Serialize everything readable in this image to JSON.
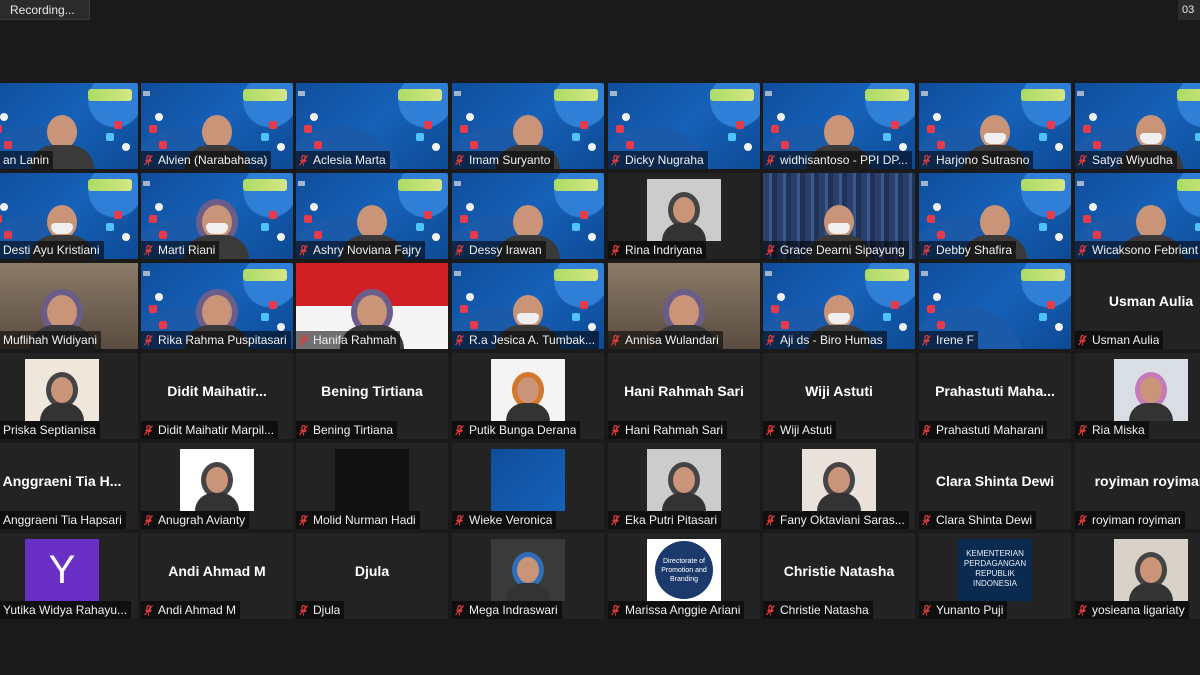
{
  "recording_label": "Recording...",
  "timer_label": "03",
  "colors": {
    "active_speaker": "#d9e86a",
    "muted_mic": "#e23b3b",
    "background": "#1a1a1a"
  },
  "participants": [
    {
      "name": "an Lanin",
      "video": "blue-person"
    },
    {
      "name": "Alvien (Narabahasa)",
      "video": "blue-person",
      "active": true
    },
    {
      "name": "Aclesia Marta",
      "video": "blue"
    },
    {
      "name": "Imam Suryanto",
      "video": "blue-person"
    },
    {
      "name": "Dicky Nugraha",
      "video": "blue"
    },
    {
      "name": "widhisantoso - PPI DP...",
      "video": "blue-person"
    },
    {
      "name": "Harjono Sutrasno",
      "video": "blue-person-mask"
    },
    {
      "name": "Satya Wiyudha",
      "video": "blue-person-mask"
    },
    {
      "name": "Desti Ayu Kristiani",
      "video": "blue-person-mask"
    },
    {
      "name": "Marti Riani",
      "video": "blue-hijab-mask"
    },
    {
      "name": "Ashry Noviana Fajry",
      "video": "blue-person"
    },
    {
      "name": "Dessy Irawan",
      "video": "blue-person"
    },
    {
      "name": "Rina Indriyana",
      "video": "thumb-hijab"
    },
    {
      "name": "Grace Dearni Sipayung",
      "video": "shelf-mask"
    },
    {
      "name": "Debby Shafira",
      "video": "blue-person"
    },
    {
      "name": "Wicaksono Febriant",
      "video": "blue-person"
    },
    {
      "name": "Muflihah Widiyani",
      "video": "room-hijab"
    },
    {
      "name": "Rika Rahma Puspitasari",
      "video": "blue-hijab"
    },
    {
      "name": "Hanifa Rahmah",
      "video": "flag-hijab"
    },
    {
      "name": "R.a Jesica A. Tumbak...",
      "video": "blue-person-mask"
    },
    {
      "name": "Annisa Wulandari",
      "video": "room-hijab"
    },
    {
      "name": "Aji ds - Biro Humas",
      "video": "blue-person-mask"
    },
    {
      "name": "Irene F",
      "video": "blue"
    },
    {
      "name": "Usman Aulia",
      "video": "none",
      "center": "Usman Aulia"
    },
    {
      "name": "Priska Septianisa",
      "video": "thumb-light"
    },
    {
      "name": "Didit Maihatir Marpil...",
      "video": "none",
      "center": "Didit  Maihatir..."
    },
    {
      "name": "Bening Tirtiana",
      "video": "none",
      "center": "Bening Tirtiana"
    },
    {
      "name": "Putik Bunga Derana",
      "video": "thumb-orange"
    },
    {
      "name": "Hani Rahmah Sari",
      "video": "none",
      "center": "Hani Rahmah Sari"
    },
    {
      "name": "Wiji Astuti",
      "video": "none",
      "center": "Wiji Astuti"
    },
    {
      "name": "Prahastuti Maharani",
      "video": "none",
      "center": "Prahastuti  Maha..."
    },
    {
      "name": "Ria Miska",
      "video": "thumb-pink"
    },
    {
      "name": "Anggraeni Tia Hapsari",
      "video": "none",
      "center": "Anggraeni  Tia  H..."
    },
    {
      "name": "Anugrah Avianty",
      "video": "thumb-cartoon"
    },
    {
      "name": "Molid Nurman Hadi",
      "video": "thumb-dark"
    },
    {
      "name": "Wieke Veronica",
      "video": "thumb-blue"
    },
    {
      "name": "Eka Putri Pitasari",
      "video": "thumb-hijab"
    },
    {
      "name": "Fany Oktaviani Saras...",
      "video": "thumb-hijab-light"
    },
    {
      "name": "Clara Shinta Dewi",
      "video": "none",
      "center": "Clara Shinta Dewi"
    },
    {
      "name": "royiman royiman",
      "video": "none",
      "center": "royiman royiman"
    },
    {
      "name": "Yutika Widya Rahayu...",
      "video": "thumb-letter",
      "letter": "Y"
    },
    {
      "name": "Andi Ahmad M",
      "video": "none",
      "center": "Andi Ahmad M"
    },
    {
      "name": "Djula",
      "video": "none",
      "center": "Djula"
    },
    {
      "name": "Mega Indraswari",
      "video": "thumb-blue-hijab"
    },
    {
      "name": "Marissa Anggie Ariani",
      "video": "thumb-dmp",
      "logo_text": "Directorate of Promotion and Branding"
    },
    {
      "name": "Christie Natasha",
      "video": "none",
      "center": "Christie Natasha"
    },
    {
      "name": "Yunanto Puji",
      "video": "thumb-kemendag",
      "logo_text": "KEMENTERIAN PERDAGANGAN REPUBLIK INDONESIA"
    },
    {
      "name": "yosieana ligariaty",
      "video": "thumb-person"
    }
  ]
}
